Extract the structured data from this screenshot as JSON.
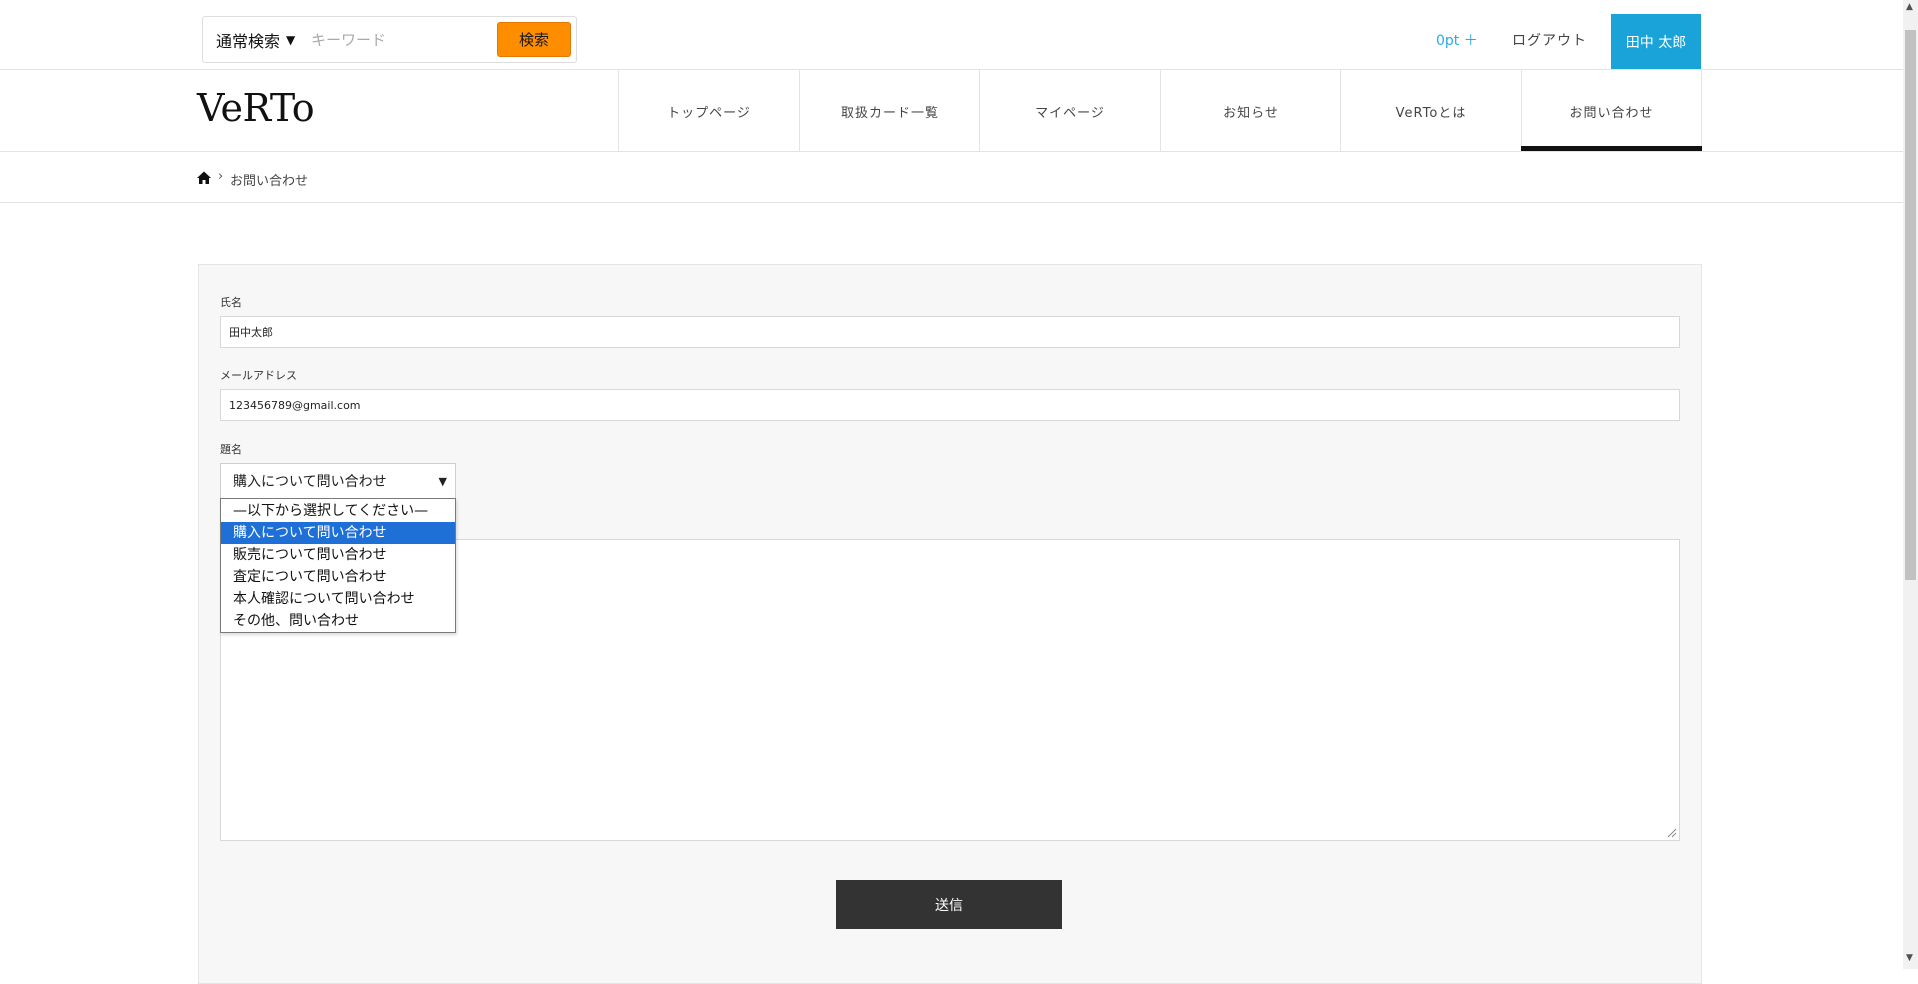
{
  "search": {
    "type_label": "通常検索",
    "placeholder": "キーワード",
    "button_label": "検索"
  },
  "account": {
    "points": "0pt ＋",
    "logout": "ログアウト",
    "user_name": "田中 太郎"
  },
  "brand": {
    "logo": "VeRTo"
  },
  "nav": {
    "items": [
      {
        "label": "トップページ"
      },
      {
        "label": "取扱カード一覧"
      },
      {
        "label": "マイページ"
      },
      {
        "label": "お知らせ"
      },
      {
        "label": "VeRToとは"
      },
      {
        "label": "お問い合わせ"
      }
    ],
    "active_index": 5
  },
  "breadcrumb": {
    "current": "お問い合わせ"
  },
  "form": {
    "name_label": "氏名",
    "name_value": "田中太郎",
    "email_label": "メールアドレス",
    "email_value": "123456789@gmail.com",
    "subject_label": "題名",
    "subject_value": "購入について問い合わせ",
    "subject_options": [
      "—以下から選択してください—",
      "購入について問い合わせ",
      "販売について問い合わせ",
      "査定について問い合わせ",
      "本人確認について問い合わせ",
      "その他、問い合わせ"
    ],
    "highlighted_option_index": 1,
    "message_value": "",
    "submit_label": "送信"
  },
  "colors": {
    "accent_orange": "#ff8d00",
    "accent_blue": "#1aa3d9",
    "selection_blue": "#1e70d6",
    "dark_button": "#333333"
  }
}
